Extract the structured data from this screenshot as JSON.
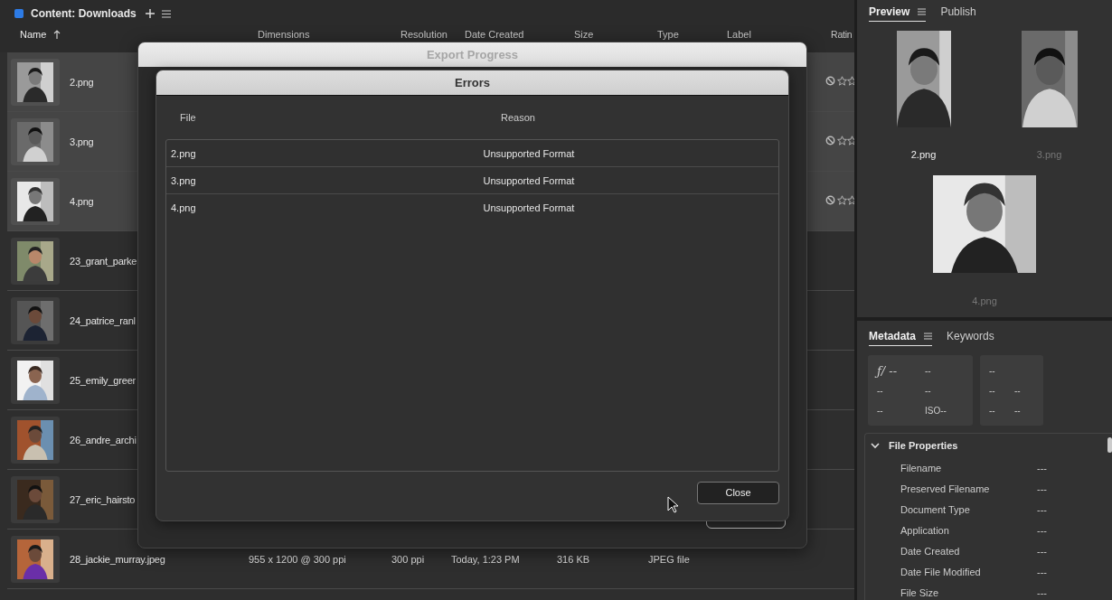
{
  "content_panel": {
    "title": "Content: Downloads",
    "columns": [
      {
        "label": "Name",
        "sorted": true
      },
      {
        "label": "Dimensions",
        "sorted": false
      },
      {
        "label": "Resolution",
        "sorted": false
      },
      {
        "label": "Date Created",
        "sorted": false
      },
      {
        "label": "Size",
        "sorted": false
      },
      {
        "label": "Type",
        "sorted": false
      },
      {
        "label": "Label",
        "sorted": false
      },
      {
        "label": "Ratin",
        "sorted": false
      }
    ],
    "rows": [
      {
        "name": "2.png",
        "selected": true
      },
      {
        "name": "3.png",
        "selected": true
      },
      {
        "name": "4.png",
        "selected": true
      },
      {
        "name": "23_grant_parke",
        "selected": false
      },
      {
        "name": "24_patrice_ranl",
        "selected": false
      },
      {
        "name": "25_emily_greer",
        "selected": false
      },
      {
        "name": "26_andre_archi",
        "selected": false
      },
      {
        "name": "27_eric_hairsto",
        "selected": false
      },
      {
        "name": "28_jackie_murray.jpeg",
        "selected": false,
        "cells": [
          "955 x 1200 @ 300 ppi",
          "300 ppi",
          "Today, 1:23 PM",
          "316 KB",
          "JPEG file"
        ]
      }
    ]
  },
  "export_dialog": {
    "title": "Export Progress"
  },
  "errors_dialog": {
    "title": "Errors",
    "columns": [
      "File",
      "Reason"
    ],
    "rows": [
      {
        "file": "2.png",
        "reason": "Unsupported Format"
      },
      {
        "file": "3.png",
        "reason": "Unsupported Format"
      },
      {
        "file": "4.png",
        "reason": "Unsupported Format"
      }
    ],
    "button": "Close"
  },
  "preview_panel": {
    "tabs": [
      {
        "label": "Preview",
        "selected": true
      },
      {
        "label": "Publish",
        "selected": false
      }
    ],
    "items": [
      {
        "name": "2.png",
        "selected": true
      },
      {
        "name": "3.png",
        "selected": false
      },
      {
        "name": "4.png",
        "selected": false
      }
    ]
  },
  "metadata_panel": {
    "tabs": [
      {
        "label": "Metadata",
        "selected": true
      },
      {
        "label": "Keywords",
        "selected": false
      }
    ],
    "exposure_boxes": [
      {
        "rows": [
          [
            "ƒ/ --",
            "--"
          ],
          [
            "--",
            "--"
          ],
          [
            "--",
            "ISO--"
          ]
        ]
      },
      {
        "rows": [
          [
            "--"
          ],
          [
            "--",
            "--"
          ],
          [
            "--",
            "--"
          ]
        ]
      }
    ],
    "section": {
      "title": "File Properties",
      "expanded": true,
      "properties": [
        {
          "label": "Filename",
          "value": "---"
        },
        {
          "label": "Preserved Filename",
          "value": "---"
        },
        {
          "label": "Document Type",
          "value": "---"
        },
        {
          "label": "Application",
          "value": "---"
        },
        {
          "label": "Date Created",
          "value": "---"
        },
        {
          "label": "Date File Modified",
          "value": "---"
        },
        {
          "label": "File Size",
          "value": "---"
        }
      ]
    }
  }
}
